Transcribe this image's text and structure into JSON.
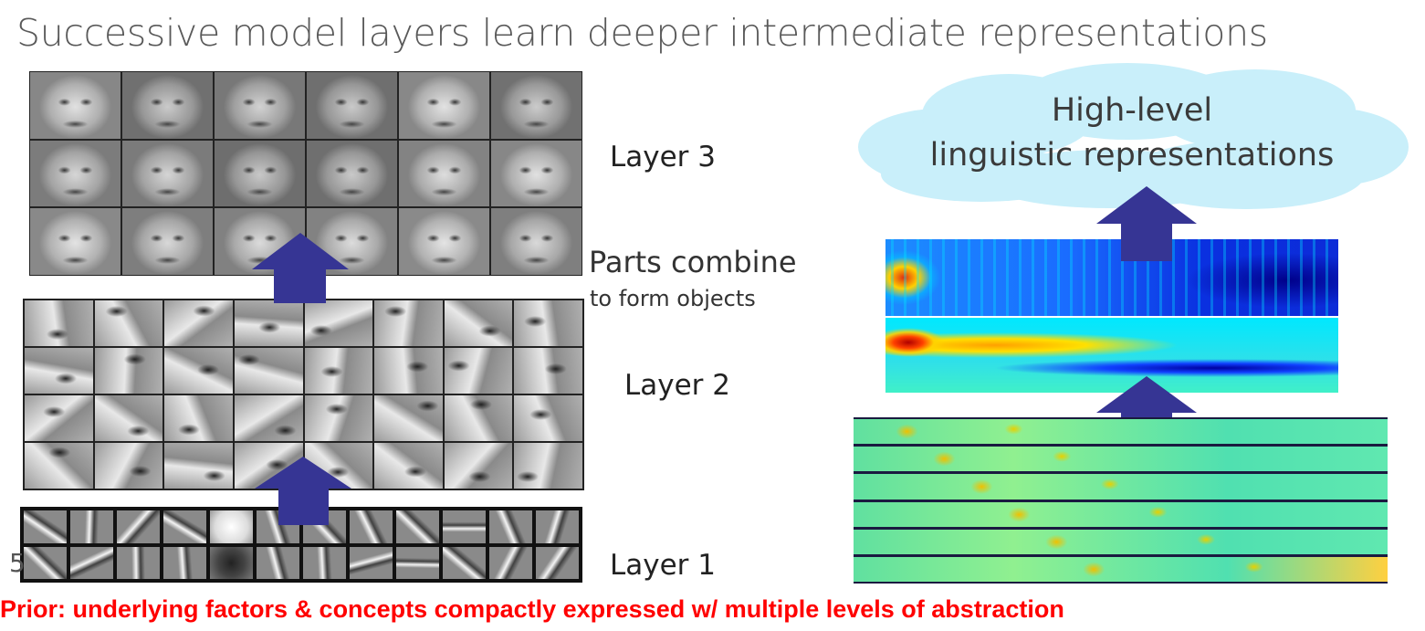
{
  "title": "Successive model layers learn deeper intermediate representations",
  "labels": {
    "layer3": "Layer 3",
    "layer2": "Layer 2",
    "layer1": "Layer 1",
    "parts_combine": "Parts combine",
    "to_form_objects": "to form objects"
  },
  "cloud": {
    "line1": "High-level",
    "line2": "linguistic representations"
  },
  "slide_number": "5",
  "footer": "Prior: underlying factors & concepts compactly expressed w/ multiple levels of abstraction",
  "colors": {
    "arrow": "#363594",
    "cloud": "#c9effa",
    "footer": "#ff0000"
  }
}
